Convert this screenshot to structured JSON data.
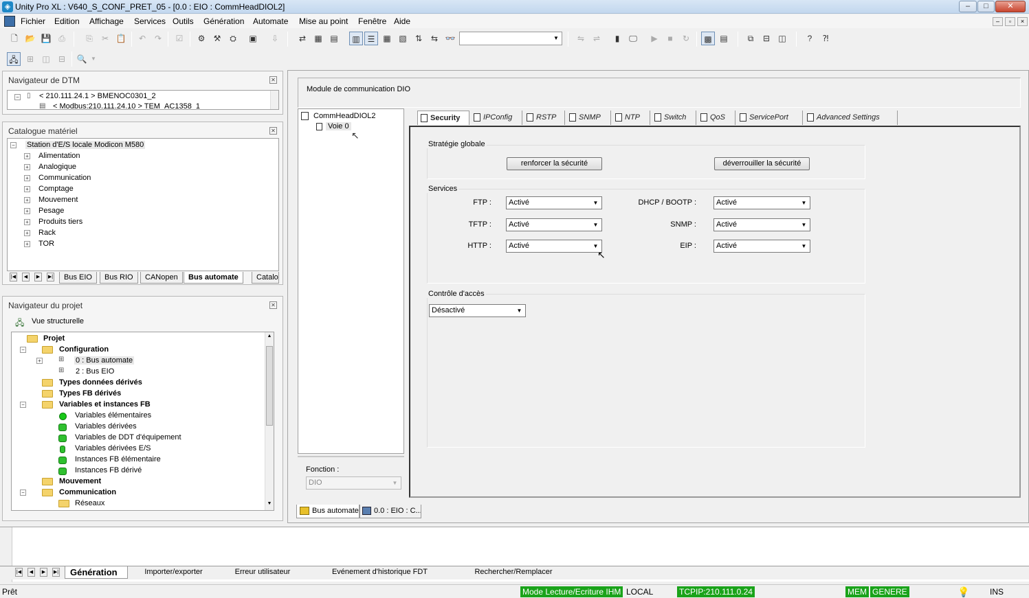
{
  "window": {
    "title": "Unity Pro XL : V640_S_CONF_PRET_05 - [0.0 : EIO : CommHeadDIOL2]",
    "controls": {
      "minimize": "–",
      "maximize": "□",
      "close": "✕"
    }
  },
  "menu": [
    "Fichier",
    "Edition",
    "Affichage",
    "Services",
    "Outils",
    "Génération",
    "Automate",
    "Mise au point",
    "Fenêtre",
    "Aide"
  ],
  "dtm_navigator": {
    "title": "Navigateur de DTM",
    "items": [
      "< 210.111.24.1 > BMENOC0301_2",
      "< Modbus:210.111.24.10 > TEM_AC1358_1"
    ]
  },
  "hardware_catalog": {
    "title": "Catalogue matériel",
    "root": "Station d'E/S locale Modicon M580",
    "items": [
      "Alimentation",
      "Analogique",
      "Communication",
      "Comptage",
      "Mouvement",
      "Pesage",
      "Produits tiers",
      "Rack",
      "TOR"
    ],
    "tabs": [
      "Bus EIO",
      "Bus RIO",
      "CANopen",
      "Bus automate",
      "Catalo"
    ],
    "active_tab": "Bus automate"
  },
  "project_navigator": {
    "title": "Navigateur du projet",
    "view": "Vue structurelle",
    "items": {
      "projet": "Projet",
      "configuration": "Configuration",
      "bus_automate": "0 : Bus automate",
      "bus_eio": "2 : Bus EIO",
      "types_donnees": "Types données dérivés",
      "types_fb": "Types FB dérivés",
      "variables": "Variables et instances FB",
      "var_elem": "Variables élémentaires",
      "var_deriv": "Variables dérivées",
      "var_ddt": "Variables de DDT d'équipement",
      "var_es": "Variables dérivées E/S",
      "inst_elem": "Instances FB élémentaire",
      "inst_deriv": "Instances FB dérivé",
      "mouvement": "Mouvement",
      "communication": "Communication",
      "reseaux": "Réseaux"
    }
  },
  "module": {
    "header": "Module de communication DIO",
    "tree": {
      "root": "CommHeadDIOL2",
      "child": "Voie 0"
    },
    "fonction_label": "Fonction :",
    "fonction_value": "DIO",
    "tabs": [
      "Security",
      "IPConfig",
      "RSTP",
      "SNMP",
      "NTP",
      "Switch",
      "QoS",
      "ServicePort",
      "Advanced Settings"
    ],
    "active_tab": "Security",
    "security": {
      "global_strategy_label": "Stratégie globale",
      "reinforce_button": "renforcer la sécurité",
      "unlock_button": "déverrouiller la sécurité",
      "services_label": "Services",
      "services": [
        {
          "label": "FTP  :",
          "value": "Activé"
        },
        {
          "label": "TFTP  :",
          "value": "Activé"
        },
        {
          "label": "HTTP  :",
          "value": "Activé"
        },
        {
          "label": "DHCP / BOOTP  :",
          "value": "Activé"
        },
        {
          "label": "SNMP  :",
          "value": "Activé"
        },
        {
          "label": "EIP  :",
          "value": "Activé"
        }
      ],
      "access_control_label": "Contrôle d'accès",
      "access_control_value": "Désactivé"
    }
  },
  "window_tabs": [
    "Bus automate",
    "0.0 : EIO : C..."
  ],
  "output_tabs": [
    "Génération",
    "Importer/exporter",
    "Erreur utilisateur",
    "Evénement d'historique FDT",
    "Rechercher/Remplacer"
  ],
  "status": {
    "ready": "Prêt",
    "mode": "Mode Lecture/Ecriture IHM",
    "local": "LOCAL",
    "tcpip": "TCPIP:210.111.0.24",
    "mem": "MEM",
    "genere": "GENERE",
    "ins": "INS"
  },
  "colors": {
    "status_green": "#1aa31a",
    "title_bar": "#c2d7ee"
  }
}
